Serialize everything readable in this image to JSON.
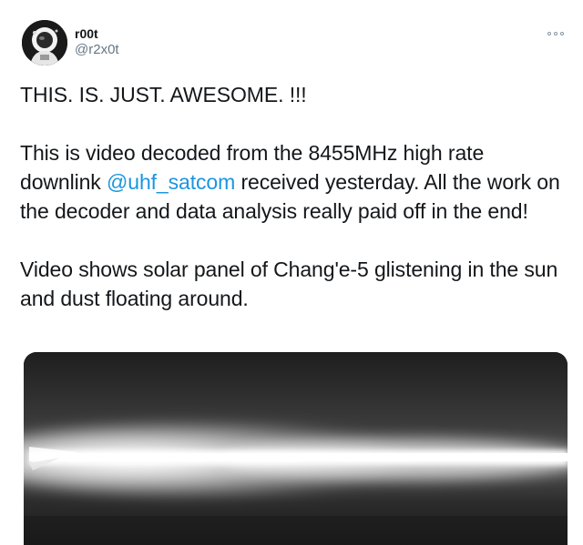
{
  "user": {
    "display_name": "r00t",
    "handle": "@r2x0t",
    "avatar_icon": "astronaut-avatar-icon"
  },
  "menu": {
    "icon": "more-options-icon"
  },
  "tweet": {
    "line1": "THIS. IS. JUST. AWESOME. !!!",
    "para2_before": "This is video decoded from the 8455MHz high rate downlink ",
    "mention": "@uhf_satcom",
    "para2_after": " received yesterday. All the work on the decoder and data analysis really paid off in the end!",
    "para3": "Video shows solar panel of Chang'e-5 glistening in the sun and dust floating around."
  },
  "colors": {
    "link": "#1b95e0",
    "text": "#14171a",
    "secondary": "#657786"
  },
  "media": {
    "type": "video-frame",
    "description_icon": "solar-panel-video-frame"
  }
}
